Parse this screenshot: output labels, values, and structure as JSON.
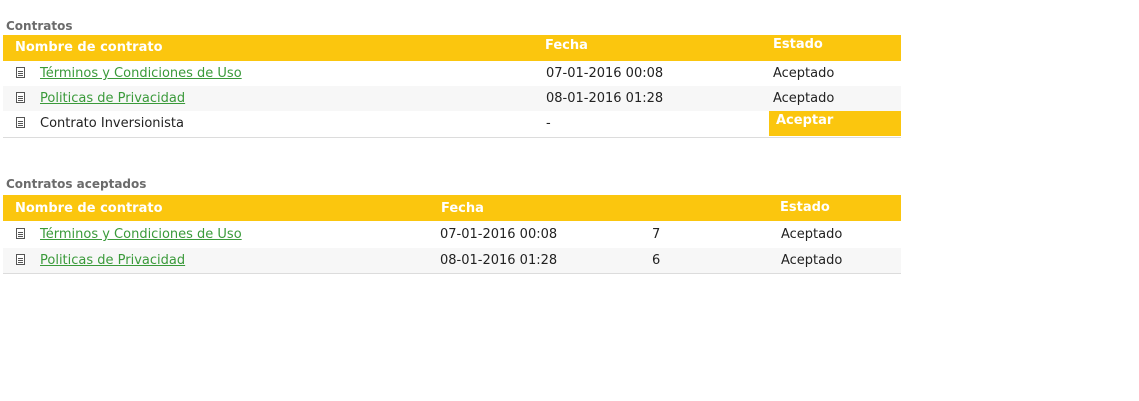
{
  "contratos": {
    "title": "Contratos",
    "headers": {
      "name": "Nombre de contrato",
      "date": "Fecha",
      "status": "Estado"
    },
    "rows": [
      {
        "name": "Términos y Condiciones de Uso",
        "date": "07-01-2016 00:08",
        "status": "Aceptado"
      },
      {
        "name": "Politicas de Privacidad",
        "date": "08-01-2016 01:28",
        "status": "Aceptado"
      },
      {
        "name": "Contrato Inversionista",
        "date": "-",
        "action": "Aceptar"
      }
    ]
  },
  "aceptados": {
    "title": "Contratos aceptados",
    "headers": {
      "name": "Nombre de contrato",
      "date": "Fecha",
      "status": "Estado"
    },
    "rows": [
      {
        "name": "Términos y Condiciones de Uso",
        "date": "07-01-2016 00:08",
        "number": "7",
        "status": "Aceptado"
      },
      {
        "name": "Politicas de Privacidad",
        "date": "08-01-2016 01:28",
        "number": "6",
        "status": "Aceptado"
      }
    ]
  },
  "colors": {
    "header_bg": "#fbc60e",
    "link": "#3a9a3a",
    "title": "#6b6b6b"
  },
  "icons": {
    "document": "document-icon"
  }
}
